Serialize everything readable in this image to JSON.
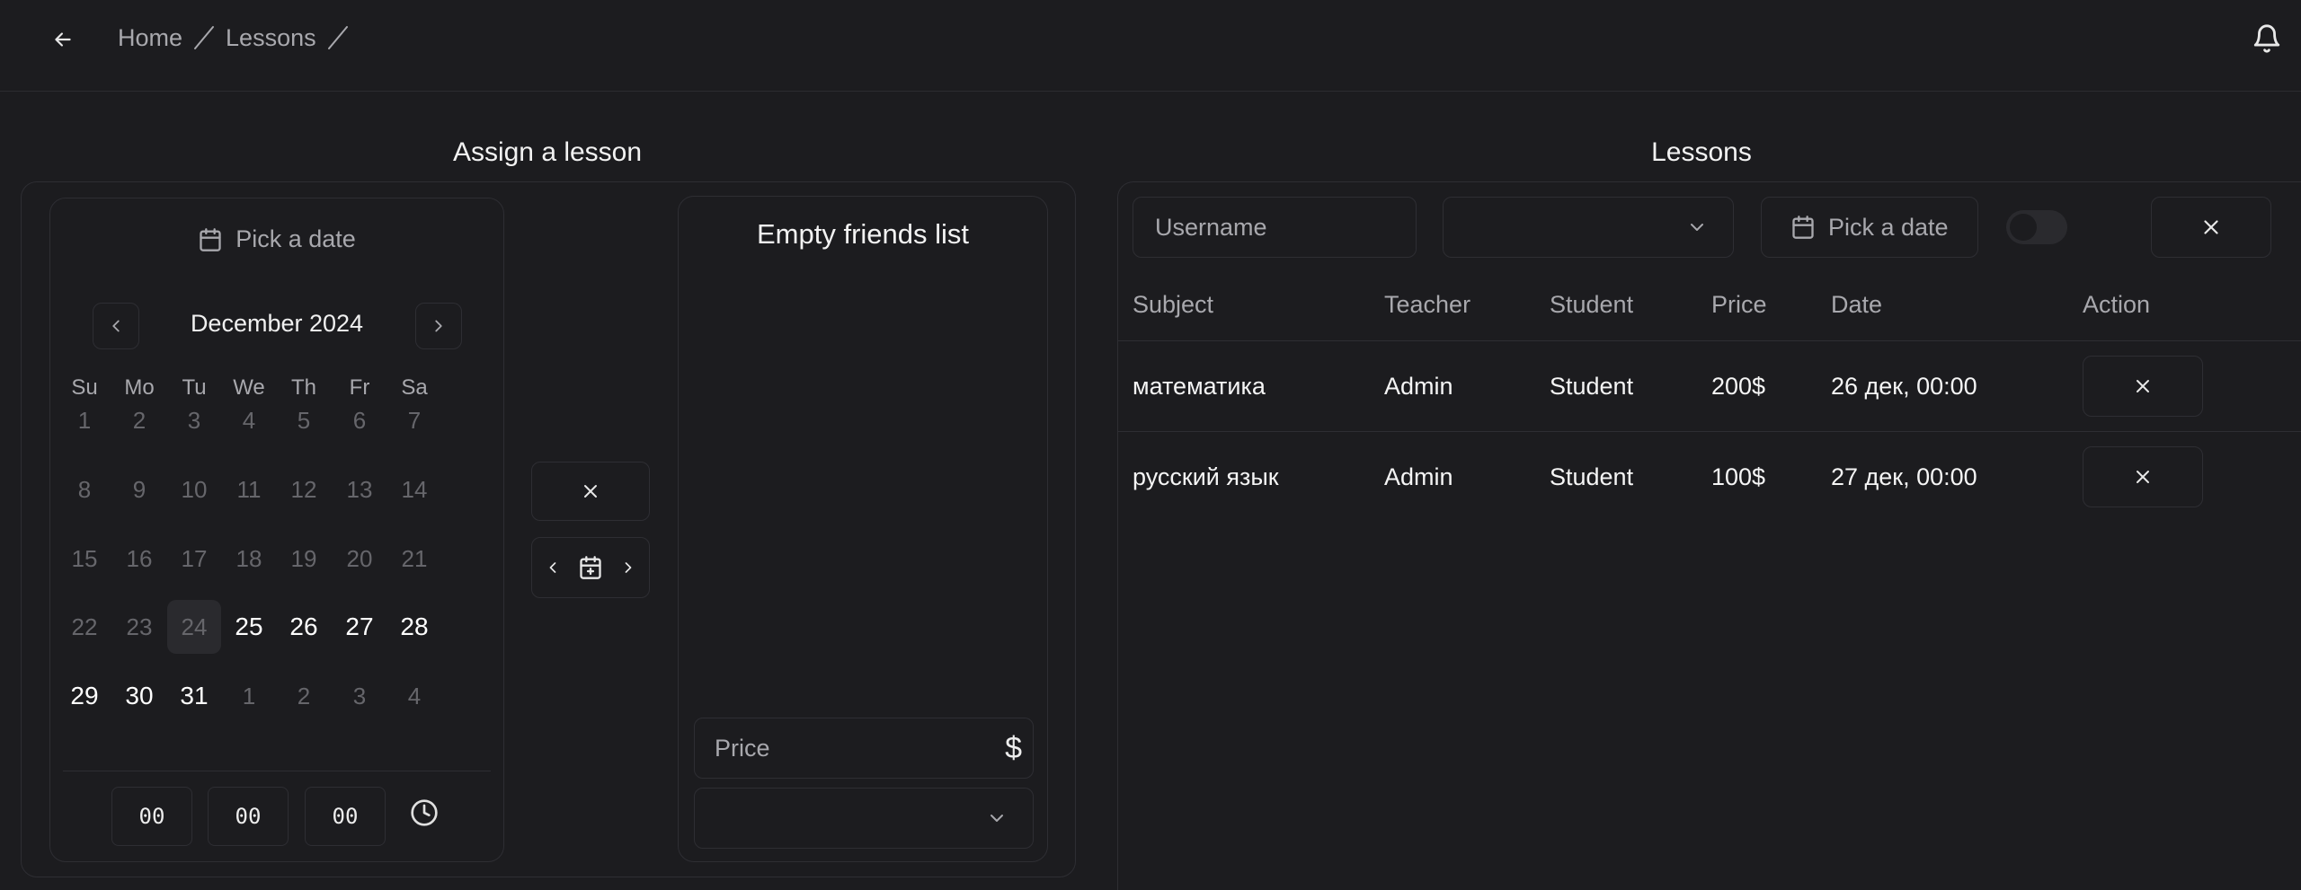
{
  "header": {
    "breadcrumb": [
      "Home",
      "Lessons"
    ]
  },
  "assign": {
    "title": "Assign a lesson",
    "pick_date": "Pick a date",
    "month": "December 2024",
    "weekdays": [
      "Su",
      "Mo",
      "Tu",
      "We",
      "Th",
      "Fr",
      "Sa"
    ],
    "weeks": [
      [
        "1",
        "2",
        "3",
        "4",
        "5",
        "6",
        "7"
      ],
      [
        "8",
        "9",
        "10",
        "11",
        "12",
        "13",
        "14"
      ],
      [
        "15",
        "16",
        "17",
        "18",
        "19",
        "20",
        "21"
      ],
      [
        "22",
        "23",
        "24",
        "25",
        "26",
        "27",
        "28"
      ],
      [
        "29",
        "30",
        "31",
        "1",
        "2",
        "3",
        "4"
      ]
    ],
    "time": {
      "hours": "00",
      "minutes": "00",
      "seconds": "00"
    },
    "friends_title": "Empty friends list",
    "price_placeholder": "Price",
    "currency_symbol": "$"
  },
  "lessons": {
    "title": "Lessons",
    "filters": {
      "username_placeholder": "Username",
      "pick_date": "Pick a date"
    },
    "columns": [
      "Subject",
      "Teacher",
      "Student",
      "Price",
      "Date",
      "Action"
    ],
    "rows": [
      {
        "subject": "математика",
        "teacher": "Admin",
        "student": "Student",
        "price": "200$",
        "date": "26 дек, 00:00"
      },
      {
        "subject": "русский язык",
        "teacher": "Admin",
        "student": "Student",
        "price": "100$",
        "date": "27 дек, 00:00"
      }
    ]
  },
  "colors": {
    "background": "#1c1c1f",
    "border": "#2e2e33",
    "muted_text": "#a8a8ad",
    "text": "#ededed"
  }
}
